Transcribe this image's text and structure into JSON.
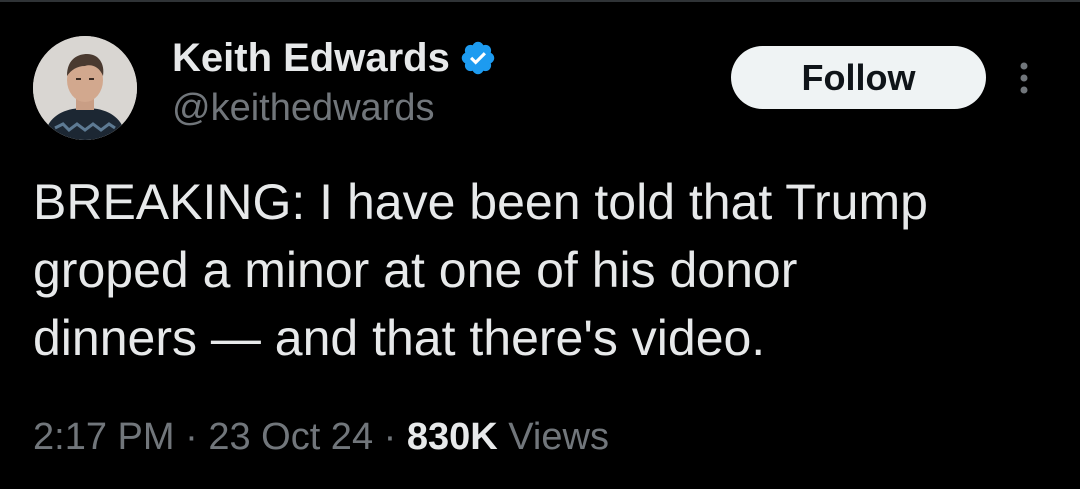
{
  "author": {
    "display_name": "Keith Edwards",
    "handle": "@keithedwards",
    "verified_icon": "verified-badge-icon",
    "verified_color": "#1d9bf0"
  },
  "follow_button": {
    "label": "Follow"
  },
  "more_menu": {
    "icon": "more-vertical-icon"
  },
  "tweet": {
    "lines": [
      "BREAKING: I have been told that Trump",
      "groped a minor at one of his donor",
      "dinners — and that there's video."
    ]
  },
  "meta": {
    "time": "2:17 PM",
    "separator": "·",
    "date": "23 Oct 24",
    "views_count": "830K",
    "views_label": "Views"
  },
  "colors": {
    "background": "#000000",
    "text_primary": "#e7e9ea",
    "text_secondary": "#71767b",
    "button_bg": "#eff3f4"
  }
}
